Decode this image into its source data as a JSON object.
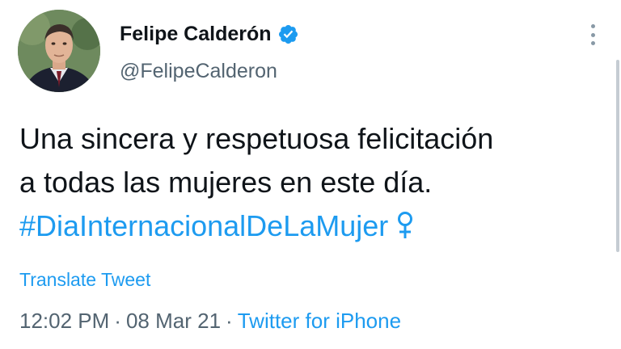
{
  "author": {
    "display_name": "Felipe Calderón",
    "handle": "@FelipeCalderon",
    "verified_icon": "verified-badge-icon",
    "verified_color": "#1d9bf0"
  },
  "menu": {
    "icon": "more-vertical-icon"
  },
  "tweet": {
    "line_1": "Una sincera y respetuosa felicitación",
    "line_2": "a todas las mujeres en este día.",
    "hashtag": "#DiaInternacionalDeLaMujer",
    "emoji": "♀",
    "emoji_icon": "female-sign-icon"
  },
  "translate_label": "Translate Tweet",
  "meta": {
    "time": "12:02 PM",
    "separator": "·",
    "date": "08 Mar 21",
    "source": "Twitter for iPhone"
  },
  "colors": {
    "text": "#0f1419",
    "secondary": "#536471",
    "accent": "#1d9bf0"
  }
}
